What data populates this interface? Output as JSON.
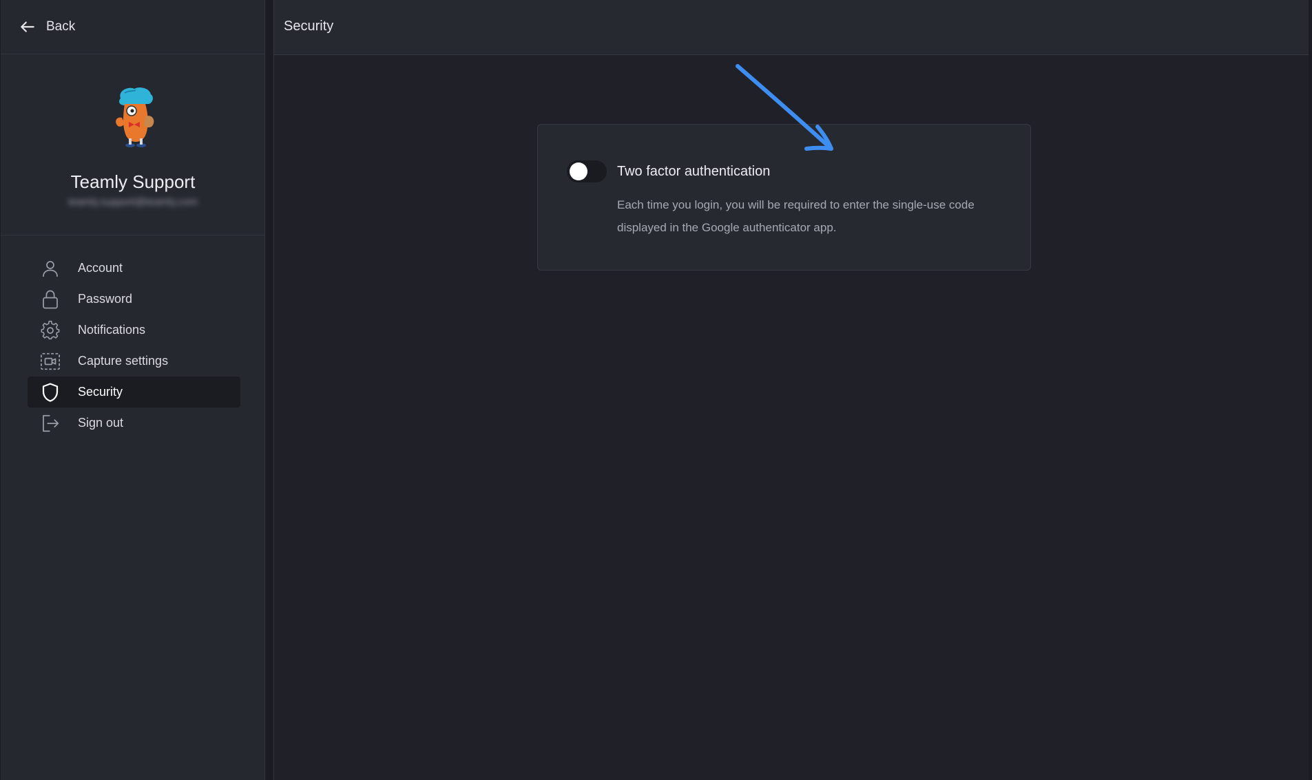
{
  "back": {
    "label": "Back"
  },
  "profile": {
    "name": "Teamly Support",
    "email": "teamly.support@teamly.com"
  },
  "sidebar": {
    "items": [
      {
        "label": "Account",
        "icon": "user-icon",
        "active": false
      },
      {
        "label": "Password",
        "icon": "lock-icon",
        "active": false
      },
      {
        "label": "Notifications",
        "icon": "gear-icon",
        "active": false
      },
      {
        "label": "Capture settings",
        "icon": "video-capture-icon",
        "active": false
      },
      {
        "label": "Security",
        "icon": "shield-icon",
        "active": true
      },
      {
        "label": "Sign out",
        "icon": "sign-out-icon",
        "active": false
      }
    ]
  },
  "main": {
    "title": "Security",
    "two_factor": {
      "title": "Two factor authentication",
      "description": "Each time you login, you will be required to enter the single-use code displayed in the Google authenticator app.",
      "enabled": false
    }
  },
  "colors": {
    "annotation_arrow": "#3d8ef0",
    "sidebar_bg": "#262830",
    "main_bg": "#1f2028",
    "active_item_bg": "#1b1c22"
  }
}
